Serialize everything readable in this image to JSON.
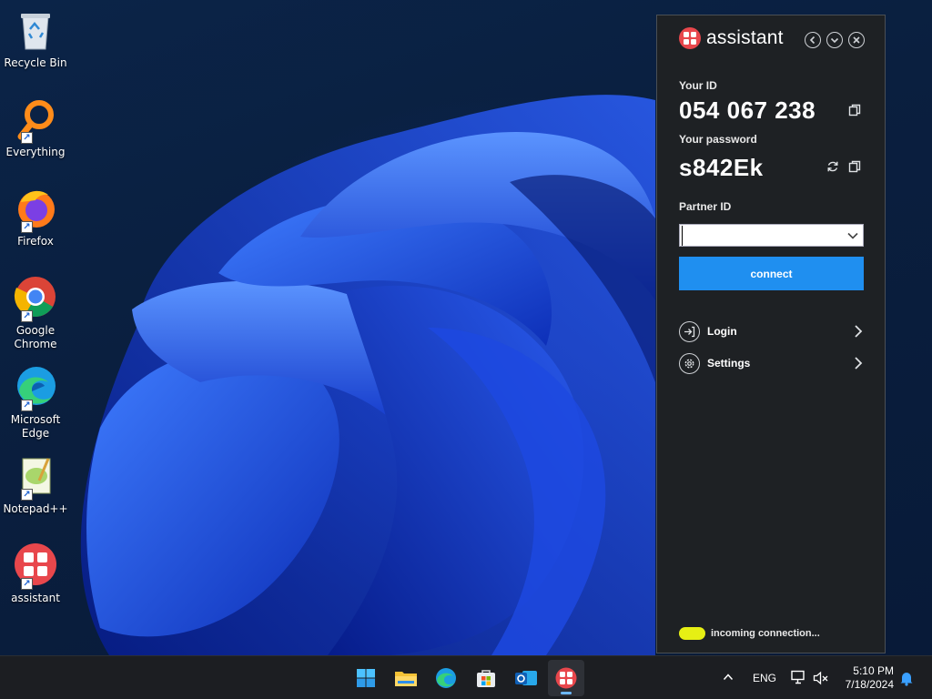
{
  "desktop": {
    "icons": [
      {
        "label": "Recycle Bin"
      },
      {
        "label": "Everything"
      },
      {
        "label": "Firefox"
      },
      {
        "label": "Google Chrome"
      },
      {
        "label": "Microsoft Edge"
      },
      {
        "label": "Notepad++"
      },
      {
        "label": "assistant"
      }
    ]
  },
  "assistant": {
    "title": "assistant",
    "your_id_label": "Your ID",
    "your_id_value": "054 067 238",
    "password_label": "Your password",
    "password_value": "s842Ek",
    "partner_id_label": "Partner ID",
    "partner_id_value": "",
    "connect_label": "connect",
    "menu": [
      {
        "label": "Login",
        "icon": "login-icon"
      },
      {
        "label": "Settings",
        "icon": "settings-gear-icon"
      }
    ],
    "status_text": "incoming connection...",
    "status_color": "#e6ef14",
    "accent_color": "#1f8ff0",
    "brand_color": "#e8474c"
  },
  "taskbar": {
    "apps": [
      "start-icon",
      "file-explorer-icon",
      "edge-icon",
      "store-icon",
      "outlook-icon",
      "assistant-icon"
    ],
    "active_app": "assistant-icon",
    "language": "ENG",
    "time": "5:10 PM",
    "date": "7/18/2024"
  }
}
